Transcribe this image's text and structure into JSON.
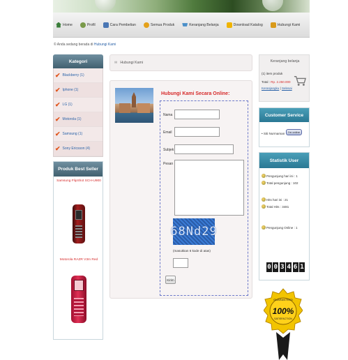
{
  "nav": {
    "items": [
      {
        "label": "Home",
        "icon": "home-icon"
      },
      {
        "label": "Profil",
        "icon": "profile-icon"
      },
      {
        "label": "Cara Pembelian",
        "icon": "guide-icon"
      },
      {
        "label": "Semua Produk",
        "icon": "product-icon"
      },
      {
        "label": "Keranjang Belanja",
        "icon": "cart-icon"
      },
      {
        "label": "Download Katalog",
        "icon": "download-icon"
      },
      {
        "label": "Hubungi Kami",
        "icon": "contact-icon"
      }
    ]
  },
  "breadcrumb": {
    "prefix": "© Anda sedang berada di",
    "current": "Hubungi Kami"
  },
  "kategori": {
    "title": "Kategori",
    "items": [
      "Blackberry (1)",
      "Iphone (1)",
      "LG (1)",
      "Motorola (1)",
      "Samsung (1)",
      "Sony Ericsson (4)"
    ]
  },
  "best_seller": {
    "title": "Produk Best Seller",
    "products": [
      "Samsung FlipShot SCH-U900",
      "Motorola RAZR V3m Red"
    ]
  },
  "page": {
    "title": "Hubungi Kami"
  },
  "form": {
    "heading": "Hubungi Kami Secara Online:",
    "nama_label": "Nama",
    "email_label": "Email",
    "subjek_label": "Subjek",
    "pesan_label": "Pesan",
    "captcha_text": "68Nd29",
    "captcha_note": "(masukkan 6 kode di atas)",
    "submit_label": "Kirim"
  },
  "cart": {
    "title": "Keranjang belanja",
    "items_text": "(1) item produk",
    "total_label": "Total :",
    "total_value": "Rp. 2.250.000",
    "link_view": "Keranjangku",
    "link_checkout": "Selesai"
  },
  "customer_service": {
    "title": "Customer Service",
    "agent_label": "• Siti Nurmaman",
    "status": "I'm online"
  },
  "statistik": {
    "title": "Statistik User",
    "lines": [
      "Pengunjung hari ini : 1",
      "Total pengunjung : 102",
      "Hits hari ini : 21",
      "Total Hits : 3481",
      "Pengunjung Online : 1"
    ],
    "counter": [
      "0",
      "0",
      "3",
      "4",
      "6",
      "1"
    ]
  },
  "seal": {
    "top_text": "GUARANTEED",
    "big_text": "100%",
    "bottom_text": "SATISFACTION"
  }
}
